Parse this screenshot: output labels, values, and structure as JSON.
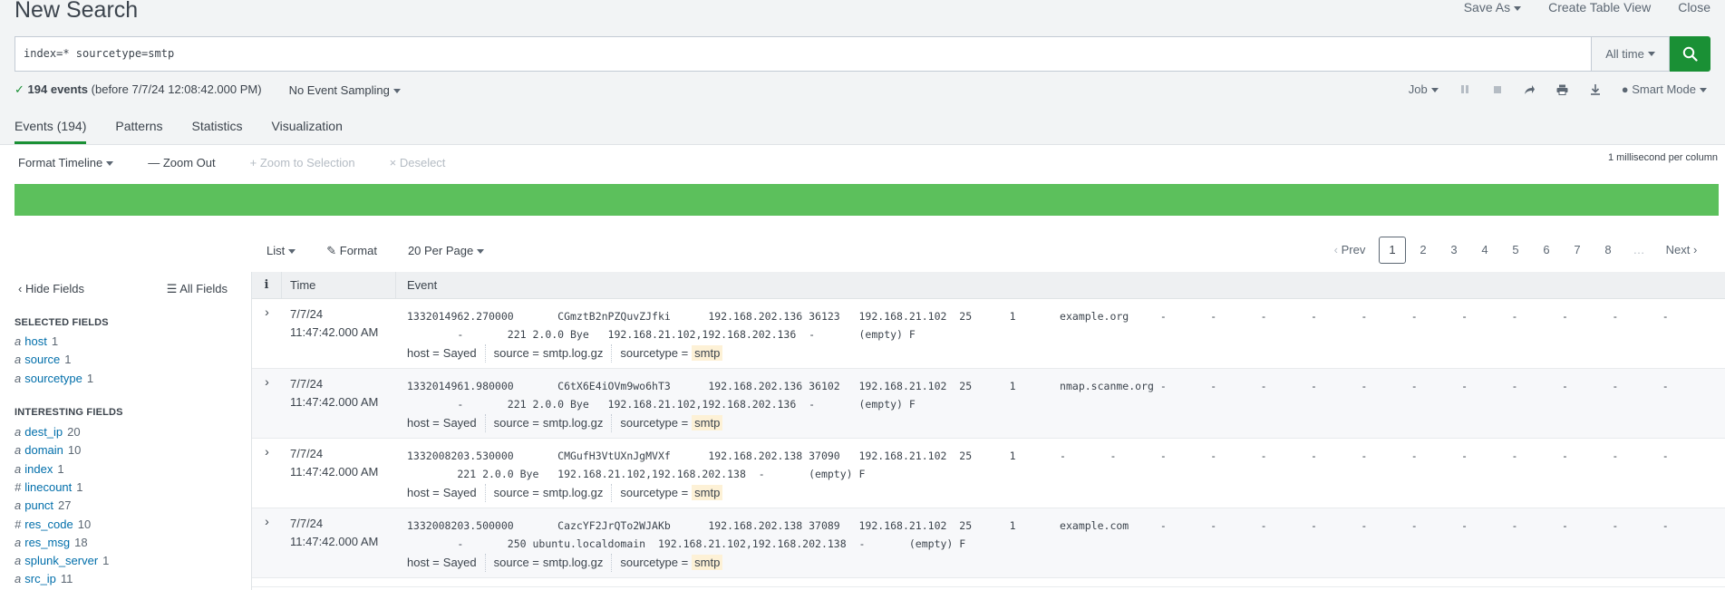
{
  "header": {
    "title": "New Search",
    "actions": [
      "Save As",
      "Create Table View",
      "Close"
    ]
  },
  "search": {
    "query": "index=* sourcetype=smtp",
    "time_range": "All time"
  },
  "status": {
    "count_bold": "194 events",
    "count_rest": "(before 7/7/24 12:08:42.000 PM)",
    "sampling": "No Event Sampling",
    "job": "Job",
    "mode": "Smart Mode"
  },
  "tabs": [
    "Events (194)",
    "Patterns",
    "Statistics",
    "Visualization"
  ],
  "timeline": {
    "format": "Format Timeline",
    "zoom_out": "Zoom Out",
    "zoom_sel": "Zoom to Selection",
    "deselect": "Deselect",
    "scale": "1 millisecond per column"
  },
  "results": {
    "list": "List",
    "format": "Format",
    "per_page": "20 Per Page",
    "prev": "Prev",
    "pages": [
      "1",
      "2",
      "3",
      "4",
      "5",
      "6",
      "7",
      "8",
      "…"
    ],
    "next": "Next"
  },
  "sidebar": {
    "hide": "Hide Fields",
    "all": "All Fields",
    "selected_title": "SELECTED FIELDS",
    "selected": [
      {
        "type": "a",
        "name": "host",
        "count": "1"
      },
      {
        "type": "a",
        "name": "source",
        "count": "1"
      },
      {
        "type": "a",
        "name": "sourcetype",
        "count": "1"
      }
    ],
    "interesting_title": "INTERESTING FIELDS",
    "interesting": [
      {
        "type": "a",
        "name": "dest_ip",
        "count": "20"
      },
      {
        "type": "a",
        "name": "domain",
        "count": "10"
      },
      {
        "type": "a",
        "name": "index",
        "count": "1"
      },
      {
        "type": "#",
        "name": "linecount",
        "count": "1"
      },
      {
        "type": "a",
        "name": "punct",
        "count": "27"
      },
      {
        "type": "#",
        "name": "res_code",
        "count": "10"
      },
      {
        "type": "a",
        "name": "res_msg",
        "count": "18"
      },
      {
        "type": "a",
        "name": "splunk_server",
        "count": "1"
      },
      {
        "type": "a",
        "name": "src_ip",
        "count": "11"
      }
    ]
  },
  "table": {
    "col_info": "i",
    "col_time": "Time",
    "col_event": "Event",
    "rows": [
      {
        "date": "7/7/24",
        "time": "11:47:42.000 AM",
        "line1": "1332014962.270000       CGmztB2nPZQuvZJfki      192.168.202.136 36123   192.168.21.102  25      1       example.org     -       -       -       -       -       -       -       -       -       -       -",
        "line2": "        -       221 2.0.0 Bye   192.168.21.102,192.168.202.136  -       (empty) F",
        "host": "Sayed",
        "source": "smtp.log.gz",
        "sourcetype": "smtp"
      },
      {
        "date": "7/7/24",
        "time": "11:47:42.000 AM",
        "line1": "1332014961.980000       C6tX6E4iOVm9wo6hT3      192.168.202.136 36102   192.168.21.102  25      1       nmap.scanme.org -       -       -       -       -       -       -       -       -       -       -",
        "line2": "        -       221 2.0.0 Bye   192.168.21.102,192.168.202.136  -       (empty) F",
        "host": "Sayed",
        "source": "smtp.log.gz",
        "sourcetype": "smtp"
      },
      {
        "date": "7/7/24",
        "time": "11:47:42.000 AM",
        "line1": "1332008203.530000       CMGufH3VtUXnJgMVXf      192.168.202.138 37090   192.168.21.102  25      1       -       -       -       -       -       -       -       -       -       -       -       -       -",
        "line2": "        221 2.0.0 Bye   192.168.21.102,192.168.202.138  -       (empty) F",
        "host": "Sayed",
        "source": "smtp.log.gz",
        "sourcetype": "smtp"
      },
      {
        "date": "7/7/24",
        "time": "11:47:42.000 AM",
        "line1": "1332008203.500000       CazcYF2JrQTo2WJAKb      192.168.202.138 37089   192.168.21.102  25      1       example.com     -       -       -       -       -       -       -       -       -       -       -",
        "line2": "        -       250 ubuntu.localdomain  192.168.21.102,192.168.202.138  -       (empty) F",
        "host": "Sayed",
        "source": "smtp.log.gz",
        "sourcetype": "smtp"
      }
    ],
    "meta_labels": {
      "host": "host =",
      "source": "source =",
      "sourcetype": "sourcetype ="
    }
  },
  "colors": {
    "accent": "#1a9035",
    "timeline": "#5cc05c",
    "link": "#006eaa"
  }
}
